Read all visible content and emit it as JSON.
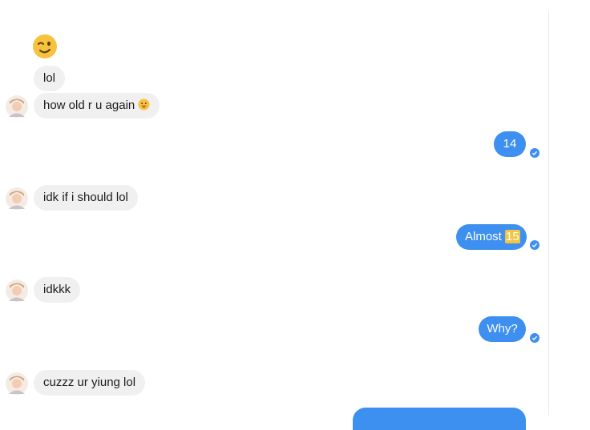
{
  "conversation": {
    "messages": [
      {
        "side": "in",
        "text": "lol"
      },
      {
        "side": "in",
        "text": "how old r u again"
      },
      {
        "side": "out",
        "text": "14"
      },
      {
        "side": "in",
        "text": "idk if i should lol"
      },
      {
        "side": "out",
        "text_before_highlight": "Almost ",
        "highlight": "15"
      },
      {
        "side": "in",
        "text": "idkkk"
      },
      {
        "side": "out",
        "text": "Why?"
      },
      {
        "side": "in",
        "text": "cuzzz ur yiung lol"
      }
    ]
  },
  "colors": {
    "outgoing_bubble": "#3d8ff0",
    "incoming_bubble": "#f0f0f0",
    "highlight": "#f2c642",
    "read_check": "#3d8ff0"
  },
  "icons": {
    "wink_emoji": "wink-emoji-icon",
    "tongue_emoji": "tongue-out-emoji-icon",
    "avatar": "avatar",
    "read_receipt": "read-check-icon"
  }
}
